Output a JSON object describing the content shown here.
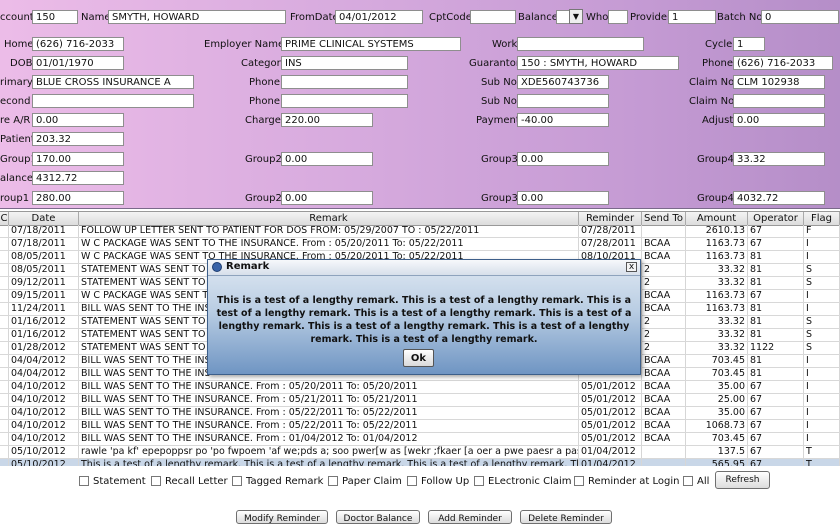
{
  "header": {
    "account_label": "ccount",
    "account": "150",
    "name_label": "Name",
    "name": "SMYTH, HOWARD",
    "fromdate_label": "FromDate",
    "fromdate": "04/01/2012",
    "cptcode_label": "CptCode",
    "cptcode": "",
    "balance_label": "Balance",
    "balance": "",
    "who_label": "Who",
    "who": "",
    "provider_label": "Provider",
    "provider": "1",
    "batch_label": "Batch No.",
    "batch": "0"
  },
  "form": {
    "home_label": "Home",
    "home": "(626) 716-2033",
    "employer_label": "Employer Name",
    "employer": "PRIME CLINICAL SYSTEMS",
    "work_label": "Work",
    "work": "",
    "cycle_label": "Cycle",
    "cycle": "1",
    "dob_label": "DOB",
    "dob": "01/01/1970",
    "category_label": "Category",
    "category": "INS",
    "guarantor_label": "Guarantor",
    "guarantor": "150 : SMYTH, HOWARD",
    "phone_label": "Phone",
    "phone_right": "(626) 716-2033",
    "primary_label": "rimary",
    "primary": "BLUE CROSS INSURANCE A",
    "phone2_label": "Phone",
    "phone2": "",
    "subno_label": "Sub No",
    "subno": "XDE560743736",
    "claimno_label": "Claim No",
    "claimno": "CLM 102938",
    "second_label": "econd",
    "second": "",
    "phone3_label": "Phone",
    "phone3": "",
    "subno2_label": "Sub No",
    "subno2": "",
    "claimno2_label": "Claim No",
    "claimno2": "",
    "prear_label": "re A/R",
    "prear": "0.00",
    "charge_label": "Charge",
    "charge": "220.00",
    "payment_label": "Payment",
    "payment": "-40.00",
    "adjust_label": "Adjust",
    "adjust": "0.00",
    "patient_label": "Patient",
    "patient": "203.32",
    "group1_label": "Group1",
    "group1": "170.00",
    "group2_label": "Group2",
    "group2": "0.00",
    "group3_label": "Group3",
    "group3": "0.00",
    "group4_label": "Group4",
    "group4": "33.32",
    "balance2_label": "alance",
    "balance2": "4312.72",
    "group1b_label": "roup1",
    "group1b": "280.00",
    "group2b_label": "Group2",
    "group2b": "0.00",
    "group3b_label": "Group3",
    "group3b": "0.00",
    "group4b_label": "Group4",
    "group4b": "4032.72"
  },
  "table": {
    "columns": [
      "C",
      "Date",
      "Remark",
      "Reminder",
      "Send To",
      "Amount",
      "Operator",
      "Flag"
    ],
    "rows": [
      {
        "date": "07/18/2011",
        "remark": "FOLLOW UP LETTER  SENT TO PATIENT FOR DOS FROM: 05/29/2007 TO : 05/22/2011",
        "reminder": "07/28/2011",
        "sendto": "",
        "amount": "2610.13",
        "operator": "67",
        "flag": "F"
      },
      {
        "date": "07/18/2011",
        "remark": "W C PACKAGE WAS SENT TO THE INSURANCE. From : 05/20/2011 To: 05/22/2011",
        "reminder": "07/28/2011",
        "sendto": "BCAA",
        "amount": "1163.73",
        "operator": "67",
        "flag": "I"
      },
      {
        "date": "08/05/2011",
        "remark": "W C PACKAGE WAS SENT TO THE INSURANCE. From : 05/20/2011 To: 05/22/2011",
        "reminder": "08/10/2011",
        "sendto": "BCAA",
        "amount": "1163.73",
        "operator": "81",
        "flag": "I"
      },
      {
        "date": "08/05/2011",
        "remark": "STATEMENT WAS SENT TO",
        "reminder": "",
        "sendto": "2",
        "amount": "33.32",
        "operator": "81",
        "flag": "S"
      },
      {
        "date": "09/12/2011",
        "remark": "STATEMENT WAS SENT TO",
        "reminder": "",
        "sendto": "2",
        "amount": "33.32",
        "operator": "81",
        "flag": "S"
      },
      {
        "date": "09/15/2011",
        "remark": "W C PACKAGE WAS SENT T",
        "reminder": "",
        "sendto": "BCAA",
        "amount": "1163.73",
        "operator": "67",
        "flag": "I"
      },
      {
        "date": "11/24/2011",
        "remark": "BILL WAS SENT TO THE INS",
        "reminder": "",
        "sendto": "BCAA",
        "amount": "1163.73",
        "operator": "81",
        "flag": "I"
      },
      {
        "date": "01/16/2012",
        "remark": "STATEMENT WAS SENT TO",
        "reminder": "",
        "sendto": "2",
        "amount": "33.32",
        "operator": "81",
        "flag": "S"
      },
      {
        "date": "01/16/2012",
        "remark": "STATEMENT WAS SENT TO",
        "reminder": "",
        "sendto": "2",
        "amount": "33.32",
        "operator": "81",
        "flag": "S"
      },
      {
        "date": "01/28/2012",
        "remark": "STATEMENT WAS SENT TO",
        "reminder": "",
        "sendto": "2",
        "amount": "33.32",
        "operator": "1122",
        "flag": "S"
      },
      {
        "date": "04/04/2012",
        "remark": "BILL WAS SENT TO THE INS",
        "reminder": "",
        "sendto": "BCAA",
        "amount": "703.45",
        "operator": "81",
        "flag": "I"
      },
      {
        "date": "04/04/2012",
        "remark": "BILL WAS SENT TO THE INS",
        "reminder": "",
        "sendto": "BCAA",
        "amount": "703.45",
        "operator": "81",
        "flag": "I"
      },
      {
        "date": "04/10/2012",
        "remark": "BILL WAS SENT TO THE INSURANCE. From : 05/20/2011 To: 05/20/2011",
        "reminder": "05/01/2012",
        "sendto": "BCAA",
        "amount": "35.00",
        "operator": "67",
        "flag": "I"
      },
      {
        "date": "04/10/2012",
        "remark": "BILL WAS SENT TO THE INSURANCE. From : 05/21/2011 To: 05/21/2011",
        "reminder": "05/01/2012",
        "sendto": "BCAA",
        "amount": "25.00",
        "operator": "67",
        "flag": "I"
      },
      {
        "date": "04/10/2012",
        "remark": "BILL WAS SENT TO THE INSURANCE. From : 05/22/2011 To: 05/22/2011",
        "reminder": "05/01/2012",
        "sendto": "BCAA",
        "amount": "35.00",
        "operator": "67",
        "flag": "I"
      },
      {
        "date": "04/10/2012",
        "remark": "BILL WAS SENT TO THE INSURANCE. From : 05/22/2011 To: 05/22/2011",
        "reminder": "05/01/2012",
        "sendto": "BCAA",
        "amount": "1068.73",
        "operator": "67",
        "flag": "I"
      },
      {
        "date": "04/10/2012",
        "remark": "BILL WAS SENT TO THE INSURANCE. From : 01/04/2012 To: 01/04/2012",
        "reminder": "05/01/2012",
        "sendto": "BCAA",
        "amount": "703.45",
        "operator": "67",
        "flag": "I"
      },
      {
        "date": "05/10/2012",
        "remark": "rawle 'pa kf' epepoppsr po  'po fwpoem 'af we;pds a;  soo pwer[w as [wekr ;fkaer [a oer a pwe paesr a paseroser...",
        "reminder": "01/04/2012",
        "sendto": "",
        "amount": "137.5",
        "operator": "67",
        "flag": "T"
      },
      {
        "date": "05/10/2012",
        "remark": "This is a test of a lengthy remark. This is a test of a lengthy remark. This is a test of a lengthy remark. This is a te...",
        "reminder": "01/04/2012",
        "sendto": "",
        "amount": "565.95",
        "operator": "67",
        "flag": "T"
      }
    ]
  },
  "dialog": {
    "title": "Remark",
    "close": "x",
    "message": "This is a test of a lengthy remark. This is a test of a lengthy remark. This is a test of a lengthy remark. This is a test of a lengthy remark. This is a test of a lengthy remark. This is a test of a lengthy remark. This is a test of a lengthy remark. This is a test of a lengthy remark.",
    "ok": "Ok"
  },
  "filters": {
    "statement": "Statement",
    "recall": "Recall Letter",
    "tagged": "Tagged Remark",
    "paper": "Paper Claim",
    "followup": "Follow Up",
    "electronic": "ELectronic Claim",
    "reminder_login": "Reminder at Login",
    "all": "All",
    "refresh": "Refresh"
  },
  "buttons": {
    "modify": "Modify Reminder",
    "doctor": "Doctor Balance",
    "add": "Add Reminder",
    "delete": "Delete Reminder"
  }
}
